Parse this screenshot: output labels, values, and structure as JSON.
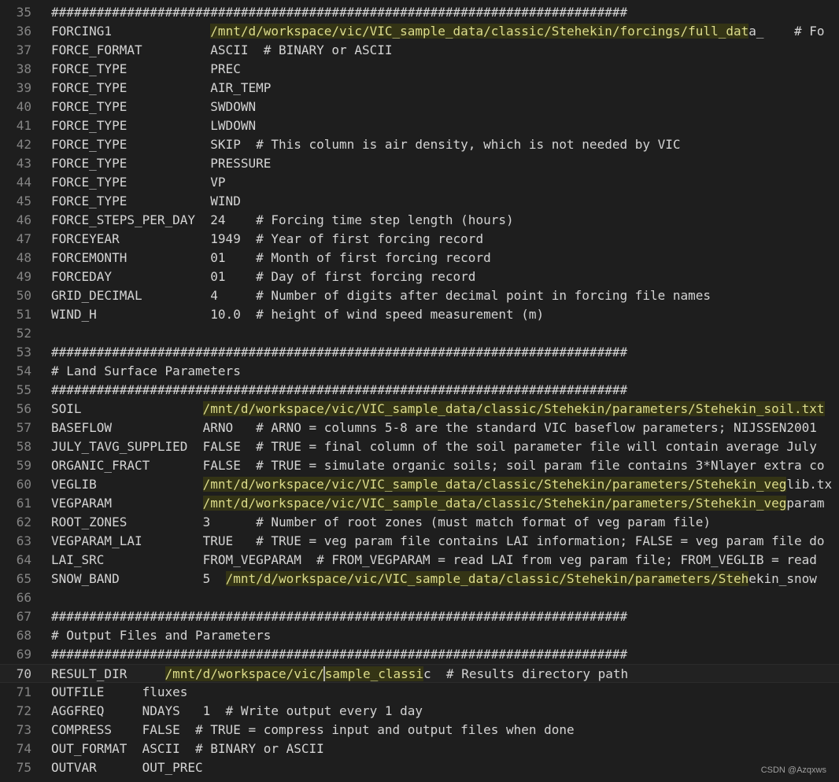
{
  "lines": [
    {
      "n": "35",
      "text": "############################################################################"
    },
    {
      "n": "36",
      "key": "FORCING1",
      "path": "/mnt/d/workspace/vic/VIC_sample_data/classic/Stehekin/forcings/full_dat",
      "tail": "a_    # Fo"
    },
    {
      "n": "37",
      "text": "FORCE_FORMAT         ASCII  # BINARY or ASCII"
    },
    {
      "n": "38",
      "text": "FORCE_TYPE           PREC"
    },
    {
      "n": "39",
      "text": "FORCE_TYPE           AIR_TEMP"
    },
    {
      "n": "40",
      "text": "FORCE_TYPE           SWDOWN"
    },
    {
      "n": "41",
      "text": "FORCE_TYPE           LWDOWN"
    },
    {
      "n": "42",
      "text": "FORCE_TYPE           SKIP  # This column is air density, which is not needed by VIC"
    },
    {
      "n": "43",
      "text": "FORCE_TYPE           PRESSURE"
    },
    {
      "n": "44",
      "text": "FORCE_TYPE           VP"
    },
    {
      "n": "45",
      "text": "FORCE_TYPE           WIND"
    },
    {
      "n": "46",
      "text": "FORCE_STEPS_PER_DAY  24    # Forcing time step length (hours)"
    },
    {
      "n": "47",
      "text": "FORCEYEAR            1949  # Year of first forcing record"
    },
    {
      "n": "48",
      "text": "FORCEMONTH           01    # Month of first forcing record"
    },
    {
      "n": "49",
      "text": "FORCEDAY             01    # Day of first forcing record"
    },
    {
      "n": "50",
      "text": "GRID_DECIMAL         4     # Number of digits after decimal point in forcing file names"
    },
    {
      "n": "51",
      "text": "WIND_H               10.0  # height of wind speed measurement (m)"
    },
    {
      "n": "52",
      "text": ""
    },
    {
      "n": "53",
      "text": "############################################################################"
    },
    {
      "n": "54",
      "text": "# Land Surface Parameters"
    },
    {
      "n": "55",
      "text": "############################################################################"
    },
    {
      "n": "56",
      "key": "SOIL",
      "path": "/mnt/d/workspace/vic/VIC_sample_data/classic/Stehekin/parameters/Stehekin_soil.txt",
      "tail": ""
    },
    {
      "n": "57",
      "text": "BASEFLOW            ARNO   # ARNO = columns 5-8 are the standard VIC baseflow parameters; NIJSSEN2001"
    },
    {
      "n": "58",
      "text": "JULY_TAVG_SUPPLIED  FALSE  # TRUE = final column of the soil parameter file will contain average July"
    },
    {
      "n": "59",
      "text": "ORGANIC_FRACT       FALSE  # TRUE = simulate organic soils; soil param file contains 3*Nlayer extra co"
    },
    {
      "n": "60",
      "key": "VEGLIB",
      "path": "/mnt/d/workspace/vic/VIC_sample_data/classic/Stehekin/parameters/Stehekin_veg",
      "tail": "lib.tx"
    },
    {
      "n": "61",
      "key": "VEGPARAM",
      "path": "/mnt/d/workspace/vic/VIC_sample_data/classic/Stehekin/parameters/Stehekin_veg",
      "tail": "param"
    },
    {
      "n": "62",
      "text": "ROOT_ZONES          3      # Number of root zones (must match format of veg param file)"
    },
    {
      "n": "63",
      "text": "VEGPARAM_LAI        TRUE   # TRUE = veg param file contains LAI information; FALSE = veg param file do"
    },
    {
      "n": "64",
      "text": "LAI_SRC             FROM_VEGPARAM  # FROM_VEGPARAM = read LAI from veg param file; FROM_VEGLIB = read"
    },
    {
      "n": "65",
      "key": "SNOW_BAND",
      "pre": "           5  ",
      "path": "/mnt/d/workspace/vic/VIC_sample_data/classic/Stehekin/parameters/Steh",
      "tail": "ekin_snow"
    },
    {
      "n": "66",
      "text": ""
    },
    {
      "n": "67",
      "text": "############################################################################"
    },
    {
      "n": "68",
      "text": "# Output Files and Parameters"
    },
    {
      "n": "69",
      "text": "############################################################################"
    },
    {
      "n": "70",
      "key": "RESULT_DIR",
      "path_a": "/mnt/d/workspace/vic/",
      "path_b": "sample_classi",
      "tail": "c  # Results directory path",
      "current": true
    },
    {
      "n": "71",
      "text": "OUTFILE     fluxes"
    },
    {
      "n": "72",
      "text": "AGGFREQ     NDAYS   1  # Write output every 1 day"
    },
    {
      "n": "73",
      "text": "COMPRESS    FALSE  # TRUE = compress input and output files when done"
    },
    {
      "n": "74",
      "text": "OUT_FORMAT  ASCII  # BINARY or ASCII"
    },
    {
      "n": "75",
      "text": "OUTVAR      OUT_PREC"
    }
  ],
  "watermark": "CSDN @Azqxws"
}
